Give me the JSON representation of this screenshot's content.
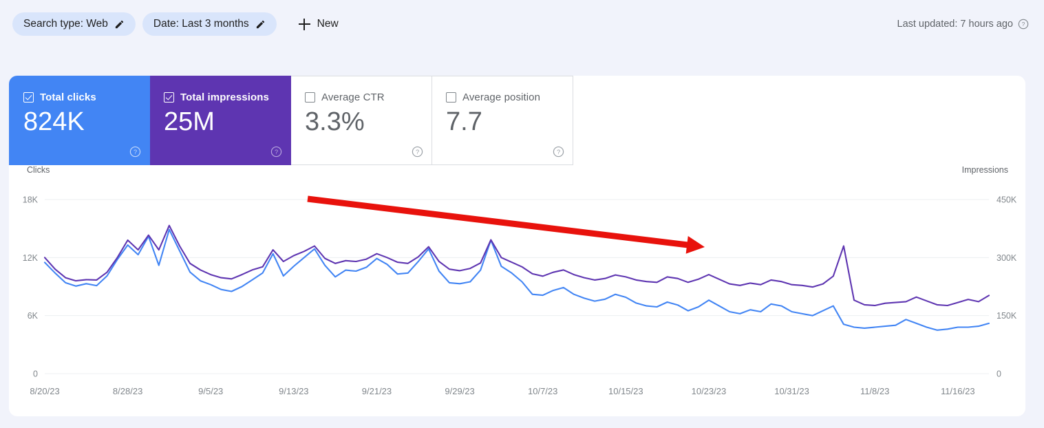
{
  "filters": {
    "search_type": {
      "label": "Search type: Web",
      "edit_icon": "pencil-icon"
    },
    "date": {
      "label": "Date: Last 3 months",
      "edit_icon": "pencil-icon"
    },
    "new": {
      "label": "New",
      "icon": "plus-icon"
    }
  },
  "status": {
    "last_updated": "Last updated: 7 hours ago",
    "help_icon": "help-circle-icon"
  },
  "metrics": [
    {
      "label": "Total clicks",
      "value": "824K",
      "checked": true,
      "color": "#4285f4",
      "help_icon": "help-circle-icon"
    },
    {
      "label": "Total impressions",
      "value": "25M",
      "checked": true,
      "color": "#5e35b1",
      "help_icon": "help-circle-icon"
    },
    {
      "label": "Average CTR",
      "value": "3.3%",
      "checked": false,
      "color": "#5f6368",
      "help_icon": "help-circle-icon"
    },
    {
      "label": "Average position",
      "value": "7.7",
      "checked": false,
      "color": "#5f6368",
      "help_icon": "help-circle-icon"
    }
  ],
  "annotation": {
    "type": "arrow",
    "color": "#e8120c",
    "from": [
      447,
      289
    ],
    "to": [
      1024,
      359
    ],
    "meaning": "downward-trend-arrow"
  },
  "chart_data": {
    "type": "line",
    "title": "",
    "xlabel": "",
    "ylabel": "Clicks",
    "y2label": "Impressions",
    "ylim": [
      0,
      18000
    ],
    "y2lim": [
      0,
      450000
    ],
    "yticks": [
      "0",
      "6K",
      "12K",
      "18K"
    ],
    "ytick_values": [
      0,
      6000,
      12000,
      18000
    ],
    "y2ticks": [
      "0",
      "150K",
      "300K",
      "450K"
    ],
    "y2tick_values": [
      0,
      150000,
      300000,
      450000
    ],
    "grid": true,
    "legend": "none",
    "xticks": [
      "8/20/23",
      "8/28/23",
      "9/5/23",
      "9/13/23",
      "9/21/23",
      "9/29/23",
      "10/7/23",
      "10/15/23",
      "10/23/23",
      "10/31/23",
      "11/8/23",
      "11/16/23"
    ],
    "xtick_indices": [
      0,
      8,
      16,
      24,
      32,
      40,
      48,
      56,
      64,
      72,
      80,
      88
    ],
    "x_start": "8/20/23",
    "x_end": "11/19/23",
    "n_points": 92,
    "series": [
      {
        "name": "Clicks",
        "color": "#4285f4",
        "axis": "left",
        "units": "clicks",
        "values": [
          11500,
          10400,
          9400,
          9050,
          9300,
          9100,
          10100,
          11800,
          13300,
          12300,
          14200,
          11200,
          14900,
          12700,
          10500,
          9600,
          9200,
          8700,
          8500,
          9000,
          9700,
          10400,
          12400,
          10100,
          11100,
          12000,
          12900,
          11200,
          10000,
          10700,
          10600,
          11000,
          11900,
          11300,
          10300,
          10400,
          11600,
          12900,
          10600,
          9400,
          9300,
          9500,
          10700,
          13800,
          11100,
          10400,
          9500,
          8200,
          8100,
          8600,
          8900,
          8200,
          7800,
          7500,
          7700,
          8200,
          7900,
          7300,
          7000,
          6900,
          7400,
          7100,
          6500,
          6900,
          7600,
          7000,
          6400,
          6200,
          6600,
          6400,
          7200,
          7000,
          6400,
          6200,
          6000,
          6500,
          7000,
          5100,
          4800,
          4700,
          4800,
          4900,
          5000,
          5600,
          5200,
          4800,
          4500,
          4600,
          4800,
          4800,
          4900,
          5200
        ]
      },
      {
        "name": "Impressions",
        "color": "#5e35b1",
        "axis": "right",
        "units": "impressions",
        "values": [
          300000,
          270000,
          248000,
          240000,
          243000,
          242000,
          262000,
          300000,
          345000,
          320000,
          358000,
          320000,
          383000,
          330000,
          285000,
          268000,
          256000,
          248000,
          245000,
          256000,
          268000,
          276000,
          320000,
          290000,
          305000,
          316000,
          330000,
          298000,
          285000,
          292000,
          290000,
          296000,
          310000,
          300000,
          288000,
          285000,
          302000,
          328000,
          290000,
          270000,
          266000,
          272000,
          286000,
          346000,
          300000,
          288000,
          276000,
          258000,
          252000,
          262000,
          268000,
          256000,
          248000,
          242000,
          246000,
          255000,
          250000,
          242000,
          238000,
          236000,
          250000,
          246000,
          236000,
          244000,
          256000,
          244000,
          232000,
          228000,
          234000,
          230000,
          242000,
          238000,
          230000,
          228000,
          224000,
          232000,
          252000,
          330000,
          190000,
          178000,
          176000,
          182000,
          184000,
          186000,
          198000,
          188000,
          178000,
          176000,
          184000,
          192000,
          186000,
          202000
        ]
      }
    ]
  }
}
